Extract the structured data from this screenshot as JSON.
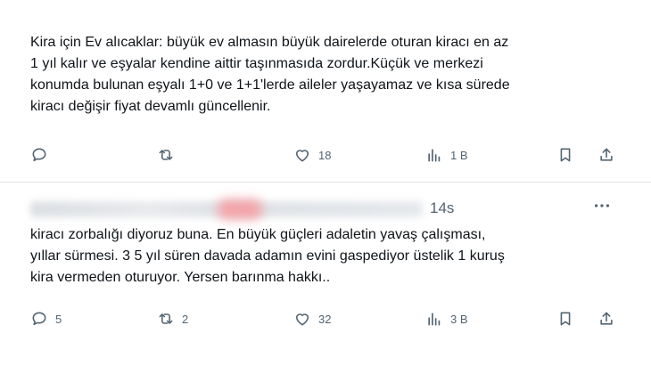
{
  "tweets": [
    {
      "text": "Kira için Ev alıcaklar:  büyük ev almasın büyük dairelerde oturan kiracı en az\n1 yıl kalır ve eşyalar kendine aittir taşınmasıda zordur.Küçük ve merkezi\nkonumda bulunan eşyalı 1+0 ve 1+1'lerde aileler yaşayamaz ve kısa sürede\nkiracı değişir fiyat devamlı güncellenir.",
      "replies": "",
      "retweets": "",
      "likes": "18",
      "views": "1 B"
    },
    {
      "time": "14s",
      "text": "kiracı zorbalığı diyoruz buna. En büyük güçleri adaletin yavaş çalışması,\nyıllar sürmesi. 3  5 yıl süren davada adamın evini gaspediyor üstelik 1 kuruş\nkira vermeden oturuyor. Yersen barınma hakkı..",
      "replies": "5",
      "retweets": "2",
      "likes": "32",
      "views": "3 B"
    }
  ],
  "icons": {
    "reply": "reply-icon",
    "retweet": "retweet-icon",
    "like": "heart-icon",
    "views": "views-icon",
    "bookmark": "bookmark-icon",
    "share": "share-icon",
    "more": "more-icon"
  },
  "colors": {
    "icon_gray": "#536471",
    "text": "#0f1419",
    "divider": "#e1e6ea"
  }
}
